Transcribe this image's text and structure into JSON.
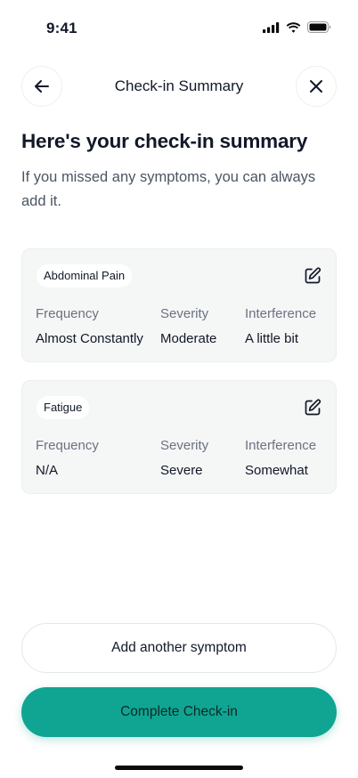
{
  "status_bar": {
    "time": "9:41"
  },
  "nav": {
    "title": "Check-in Summary"
  },
  "heading": "Here's your check-in summary",
  "subtext": "If you missed any symptoms, you can always add it.",
  "labels": {
    "frequency": "Frequency",
    "severity": "Severity",
    "interference": "Interference"
  },
  "symptoms": [
    {
      "name": "Abdominal Pain",
      "frequency": "Almost Constantly",
      "severity": "Moderate",
      "interference": "A little bit"
    },
    {
      "name": "Fatigue",
      "frequency": "N/A",
      "severity": "Severe",
      "interference": "Somewhat"
    }
  ],
  "buttons": {
    "add": "Add another symptom",
    "complete": "Complete Check-in"
  },
  "colors": {
    "accent": "#10a592"
  }
}
